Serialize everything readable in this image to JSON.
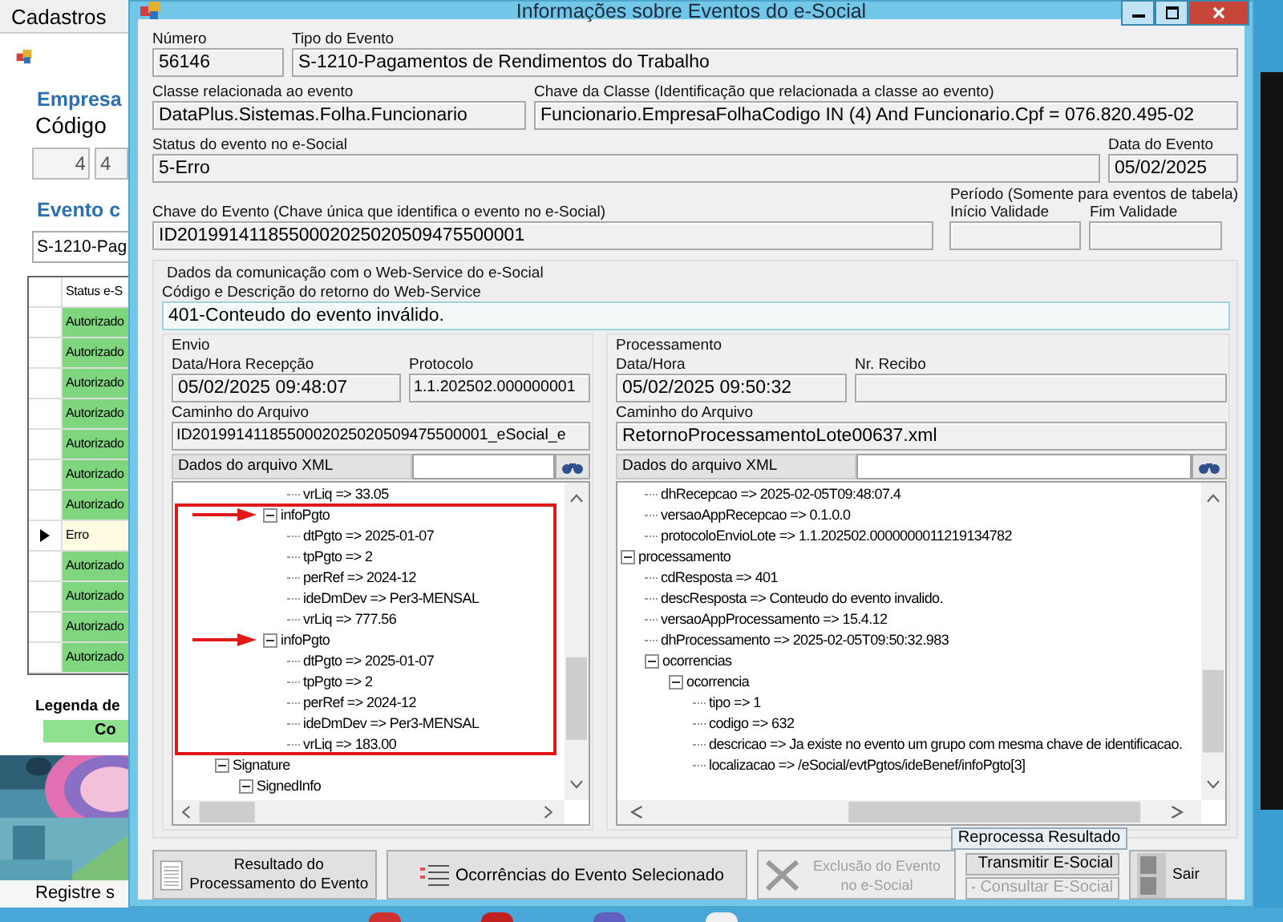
{
  "background_window": {
    "menu": "Cadastros",
    "company_heading": "Empresa",
    "code_label": "Código",
    "code_values": [
      "4",
      "4"
    ],
    "event_heading": "Evento c",
    "event_combo": "S-1210-Pag",
    "grid": {
      "column": "Status e-S",
      "rows": [
        {
          "status": "Autorizado",
          "color": "#7fd67f",
          "selected": false
        },
        {
          "status": "Autorizado",
          "color": "#7fd67f",
          "selected": false
        },
        {
          "status": "Autorizado",
          "color": "#7fd67f",
          "selected": false
        },
        {
          "status": "Autorizado",
          "color": "#7fd67f",
          "selected": false
        },
        {
          "status": "Autorizado",
          "color": "#7fd67f",
          "selected": false
        },
        {
          "status": "Autorizado",
          "color": "#7fd67f",
          "selected": false
        },
        {
          "status": "Autorizado",
          "color": "#7fd67f",
          "selected": false
        },
        {
          "status": "Erro",
          "color": "#fffbe3",
          "selected": true
        },
        {
          "status": "Autorizado",
          "color": "#7fd67f",
          "selected": false
        },
        {
          "status": "Autorizado",
          "color": "#7fd67f",
          "selected": false
        },
        {
          "status": "Autorizado",
          "color": "#7fd67f",
          "selected": false
        },
        {
          "status": "Autorizado",
          "color": "#7fd67f",
          "selected": false
        }
      ]
    },
    "legend_title": "Legenda de",
    "legend_item": {
      "label": "Co",
      "color": "#8fe08f"
    },
    "footer": "Registre s"
  },
  "window": {
    "title": "Informações sobre Eventos do e-Social"
  },
  "numero": {
    "label": "Número",
    "value": "56146"
  },
  "tipo": {
    "label": "Tipo do Evento",
    "value": "S-1210-Pagamentos de Rendimentos do Trabalho"
  },
  "classe": {
    "label": "Classe relacionada ao evento",
    "value": "DataPlus.Sistemas.Folha.Funcionario"
  },
  "chave_classe": {
    "label": "Chave da Classe (Identificação que relacionada a classe ao evento)",
    "value": "Funcionario.EmpresaFolhaCodigo IN (4) And Funcionario.Cpf = 076.820.495-02"
  },
  "status": {
    "label": "Status do evento no e-Social",
    "value": "5-Erro"
  },
  "data_evento": {
    "label": "Data do Evento",
    "value": "05/02/2025"
  },
  "chave_evento": {
    "label": "Chave do Evento (Chave única que identifica o evento no e-Social)",
    "value": "ID2019914118550002025020509475500001"
  },
  "periodo": {
    "title": "Período (Somente para eventos de tabela)",
    "inicio": {
      "label": "Início Validade"
    },
    "fim": {
      "label": "Fim Validade"
    }
  },
  "comunicacao": {
    "title": "Dados da comunicação com o Web-Service do e-Social",
    "retorno": {
      "label": "Código e Descrição do retorno do Web-Service",
      "value": "401-Conteudo do evento inválido."
    },
    "envio": {
      "title": "Envio",
      "datahora": {
        "label": "Data/Hora Recepção",
        "value": "05/02/2025 09:48:07"
      },
      "protocolo": {
        "label": "Protocolo",
        "value": "1.1.202502.000000001"
      },
      "caminho": {
        "label": "Caminho do Arquivo",
        "value": "ID2019914118550002025020509475500001_eSocial_e"
      },
      "xml": {
        "label": "Dados do arquivo XML",
        "tree": [
          {
            "children": [
              {
                "children": [
                  {
                    "children": [
                      {
                        "label": "vrLiq => 33.05"
                      }
                    ]
                  },
                  {
                    "label": "infoPgto",
                    "expanded": true,
                    "children": [
                      {
                        "label": "dtPgto => 2025-01-07"
                      },
                      {
                        "label": "tpPgto => 2"
                      },
                      {
                        "label": "perRef => 2024-12"
                      },
                      {
                        "label": "ideDmDev => Per3-MENSAL"
                      },
                      {
                        "label": "vrLiq => 777.56"
                      }
                    ]
                  },
                  {
                    "label": "infoPgto",
                    "expanded": true,
                    "children": [
                      {
                        "label": "dtPgto => 2025-01-07"
                      },
                      {
                        "label": "tpPgto => 2"
                      },
                      {
                        "label": "perRef => 2024-12"
                      },
                      {
                        "label": "ideDmDev => Per3-MENSAL"
                      },
                      {
                        "label": "vrLiq => 183.00"
                      }
                    ]
                  }
                ]
              }
            ]
          },
          {
            "label": "Signature",
            "expanded": true,
            "children": [
              {
                "label": "SignedInfo",
                "expanded": true
              }
            ]
          }
        ]
      }
    },
    "processamento": {
      "title": "Processamento",
      "datahora": {
        "label": "Data/Hora",
        "value": "05/02/2025 09:50:32"
      },
      "recibo": {
        "label": "Nr. Recibo"
      },
      "caminho": {
        "label": "Caminho do Arquivo",
        "value": "RetornoProcessamentoLote00637.xml"
      },
      "xml": {
        "label": "Dados do arquivo XML",
        "tree": [
          {
            "children": [
              {
                "label": "dhRecepcao => 2025-02-05T09:48:07.4"
              },
              {
                "label": "versaoAppRecepcao => 0.1.0.0"
              },
              {
                "label": "protocoloEnvioLote => 1.1.202502.0000000011219134782"
              }
            ]
          },
          {
            "label": "processamento",
            "expanded": true,
            "children": [
              {
                "label": "cdResposta => 401"
              },
              {
                "label": "descResposta => Conteudo do evento invalido."
              },
              {
                "label": "versaoAppProcessamento => 15.4.12"
              },
              {
                "label": "dhProcessamento => 2025-02-05T09:50:32.983"
              },
              {
                "label": "ocorrencias",
                "expanded": true,
                "children": [
                  {
                    "label": "ocorrencia",
                    "expanded": true,
                    "children": [
                      {
                        "label": "tipo => 1"
                      },
                      {
                        "label": "codigo => 632"
                      },
                      {
                        "label": "descricao => Ja existe no evento um grupo com mesma chave de identificacao."
                      },
                      {
                        "label": "localizacao => /eSocial/evtPgtos/ideBenef/infoPgto[3]"
                      }
                    ]
                  }
                ]
              }
            ]
          }
        ]
      }
    }
  },
  "buttons": [
    {
      "kind": "result",
      "label": "Resultado do Processamento do Evento",
      "disabled": false
    },
    {
      "kind": "occurrences",
      "label": "Ocorrências do Evento Selecionado",
      "disabled": false
    },
    {
      "kind": "delete",
      "label": "Exclusão do Evento no e-Social",
      "disabled": true
    }
  ],
  "esocial_buttons": [
    {
      "kind": "reprocess",
      "label": "Reprocessa Resultado",
      "disabled": false
    },
    {
      "kind": "transmit",
      "label": "Transmitir E-Social",
      "disabled": false
    },
    {
      "kind": "query",
      "label": "Consultar E-Social",
      "disabled": true
    }
  ],
  "exit_button": {
    "label": "Sair"
  }
}
